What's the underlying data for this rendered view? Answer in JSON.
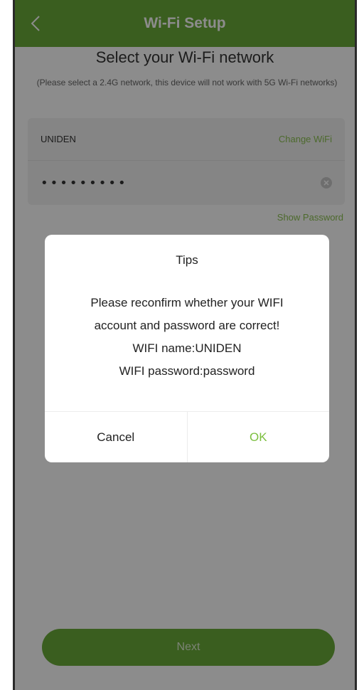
{
  "header": {
    "title": "Wi-Fi Setup",
    "back_icon": "chevron-left-icon"
  },
  "main": {
    "title": "Select your Wi-Fi network",
    "subtitle": "(Please select a 2.4G network, this device will not work with 5G Wi-Fi networks)",
    "wifi_name": "UNIDEN",
    "change_wifi_label": "Change WiFi",
    "password_value": "•••••••••",
    "clear_icon": "clear-circle-icon",
    "show_password_label": "Show Password",
    "next_label": "Next"
  },
  "dialog": {
    "title": "Tips",
    "message_lines": [
      "Please reconfirm whether your WIFI",
      "account and password are correct!",
      "WIFI name:UNIDEN",
      "WIFI password:password"
    ],
    "cancel_label": "Cancel",
    "ok_label": "OK"
  },
  "colors": {
    "accent_green": "#6aab39",
    "link_green": "#8cc152",
    "ok_green": "#7cbf3f"
  }
}
